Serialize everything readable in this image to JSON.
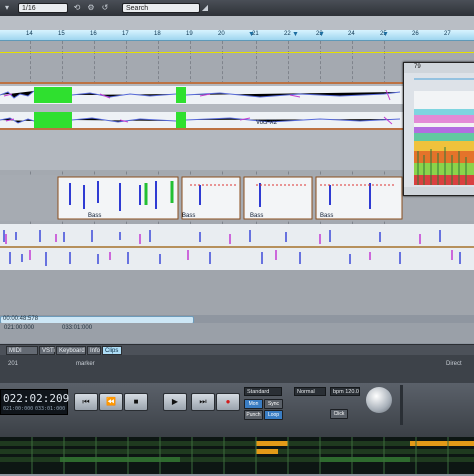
{
  "toolbar": {
    "quantize_value": "1/16",
    "search_placeholder": "Search"
  },
  "ruler": {
    "bars": [
      "14",
      "15",
      "16",
      "17",
      "18",
      "19",
      "20",
      "21",
      "22",
      "23",
      "24",
      "25",
      "26",
      "27"
    ]
  },
  "tracks": {
    "vocal_clip_label": "VocFX2",
    "bass_clip_label": "Bass"
  },
  "popup": {
    "header_value": "79"
  },
  "timeline": {
    "selection_time": "00:00:48:578",
    "start_time": "021:00:000",
    "end_time": "033:01:000"
  },
  "tabs": [
    {
      "label": "MIDI Editor"
    },
    {
      "label": "VSTi"
    },
    {
      "label": "Keyboard"
    },
    {
      "label": "Info"
    },
    {
      "label": "Clips"
    }
  ],
  "transport": {
    "position": "022:02:209",
    "sub_start": "021:00:000",
    "sub_end": "033:01:000",
    "mode_value": "Standard",
    "normal_value": "Normal",
    "bpm_value": "bpm 120.0",
    "mode_buttons": [
      "Mon",
      "Sync",
      "Punch",
      "Loop"
    ],
    "direct_label": "Direct",
    "click_label": "Click",
    "level_small": "201",
    "marker_label": "marker"
  },
  "colors": {
    "ruler": "#aee0f5",
    "accent_blue": "#1c6ea1",
    "meter_orange": "#e39a18",
    "rec_red": "#d21b1b"
  }
}
